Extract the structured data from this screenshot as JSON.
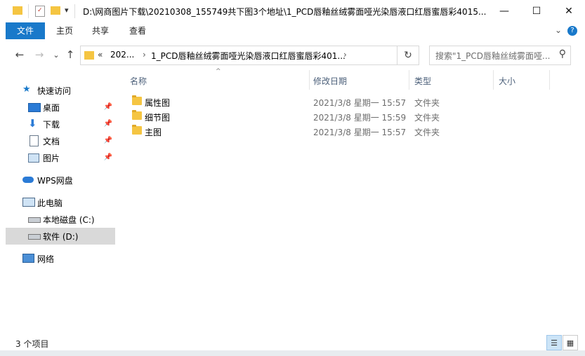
{
  "window": {
    "title": "D:\\网商图片下载\\20210308_155749共下图3个地址\\1_PCD唇釉丝绒雾面哑光染唇液口红唇蜜唇彩4015...",
    "minimize": "—",
    "maximize": "☐",
    "close": "✕"
  },
  "quick_access_toolbar": {
    "dropdown": "▾"
  },
  "ribbon": {
    "tabs": [
      "文件",
      "主页",
      "共享",
      "查看"
    ],
    "expand": "⌄",
    "help": "?"
  },
  "navigation": {
    "back": "←",
    "forward": "→",
    "recent": "⌄",
    "up": "↑",
    "address": {
      "prefix": "«",
      "segments": [
        "202...",
        "1_PCD唇釉丝绒雾面哑光染唇液口红唇蜜唇彩401..."
      ],
      "separator": "›",
      "dropdown": "›"
    },
    "refresh": "↻",
    "search_placeholder": "搜索\"1_PCD唇釉丝绒雾面哑...",
    "search_icon": "⚲"
  },
  "sidebar": {
    "quick_access": "快速访问",
    "items": [
      {
        "label": "桌面",
        "icon": "desktop-icon",
        "pinned": true
      },
      {
        "label": "下载",
        "icon": "download-icon",
        "pinned": true
      },
      {
        "label": "文档",
        "icon": "document-icon",
        "pinned": true
      },
      {
        "label": "图片",
        "icon": "picture-icon",
        "pinned": true
      }
    ],
    "wps": "WPS网盘",
    "this_pc": "此电脑",
    "drives": [
      {
        "label": "本地磁盘 (C:)",
        "selected": false
      },
      {
        "label": "软件 (D:)",
        "selected": true
      }
    ],
    "network": "网络",
    "pin_glyph": "📌"
  },
  "columns": {
    "name": "名称",
    "date": "修改日期",
    "type": "类型",
    "size": "大小",
    "sort_indicator": "^"
  },
  "files": [
    {
      "name": "属性图",
      "date": "2021/3/8 星期一 15:57",
      "type": "文件夹"
    },
    {
      "name": "细节图",
      "date": "2021/3/8 星期一 15:59",
      "type": "文件夹"
    },
    {
      "name": "主图",
      "date": "2021/3/8 星期一 15:57",
      "type": "文件夹"
    }
  ],
  "status": {
    "item_count": "3 个项目"
  },
  "colors": {
    "accent": "#1979ca",
    "selected_bg": "#d9d9d9",
    "folder": "#f5c542"
  }
}
